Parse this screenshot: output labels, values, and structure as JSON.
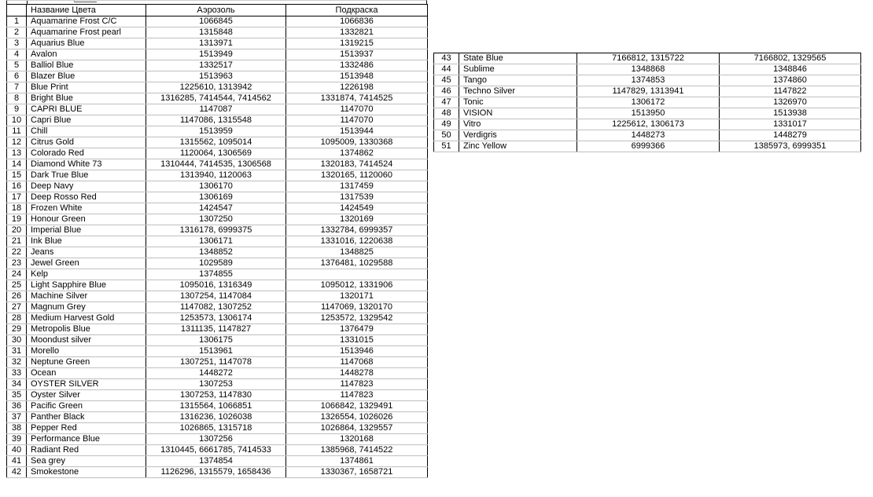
{
  "table": {
    "headers": {
      "row_number": "",
      "name": "Название Цвета",
      "aerosol": "Аэрозоль",
      "tint": "Подкраска"
    }
  },
  "left_table": {
    "rows": [
      {
        "n": "1",
        "name": "Aquamarine Frost C/C",
        "aerosol": "1066845",
        "tint": "1066836"
      },
      {
        "n": "2",
        "name": "Aquamarine Frost pearl",
        "aerosol": "1315848",
        "tint": "1332821"
      },
      {
        "n": "3",
        "name": "Aquarius Blue",
        "aerosol": "1313971",
        "tint": "1319215"
      },
      {
        "n": "4",
        "name": "Avalon",
        "aerosol": "1513949",
        "tint": "1513937"
      },
      {
        "n": "5",
        "name": "Balliol  Blue",
        "aerosol": "1332517",
        "tint": "1332486"
      },
      {
        "n": "6",
        "name": "Blazer Blue",
        "aerosol": "1513963",
        "tint": "1513948"
      },
      {
        "n": "7",
        "name": "Blue Print",
        "aerosol": "1225610, 1313942",
        "tint": "1226198"
      },
      {
        "n": "8",
        "name": "Bright Blue",
        "aerosol": "1316285, 7414544, 7414562",
        "tint": "1331874, 7414525"
      },
      {
        "n": "9",
        "name": "CAPRI BLUE",
        "aerosol": "1147087",
        "tint": "1147070"
      },
      {
        "n": "10",
        "name": "Capri Blue",
        "aerosol": "1147086, 1315548",
        "tint": "1147070"
      },
      {
        "n": "11",
        "name": "Chill",
        "aerosol": "1513959",
        "tint": "1513944"
      },
      {
        "n": "12",
        "name": "Citrus Gold",
        "aerosol": "1315562, 1095014",
        "tint": "1095009, 1330368"
      },
      {
        "n": "13",
        "name": "Colorado Red",
        "aerosol": "1120064, 1306569",
        "tint": "1374862"
      },
      {
        "n": "14",
        "name": "Diamond White 73",
        "aerosol": "1310444, 7414535, 1306568",
        "tint": "1320183, 7414524"
      },
      {
        "n": "15",
        "name": "Dark True Blue",
        "aerosol": "1313940, 1120063",
        "tint": "1320165, 1120060"
      },
      {
        "n": "16",
        "name": "Deep Navy",
        "aerosol": "1306170",
        "tint": "1317459"
      },
      {
        "n": "17",
        "name": "Deep Rosso Red",
        "aerosol": "1306169",
        "tint": "1317539"
      },
      {
        "n": "18",
        "name": "Frozen White",
        "aerosol": "1424547",
        "tint": "1424549"
      },
      {
        "n": "19",
        "name": "Honour  Green",
        "aerosol": "1307250",
        "tint": "1320169"
      },
      {
        "n": "20",
        "name": "Imperial Blue",
        "aerosol": "1316178, 6999375",
        "tint": "1332784, 6999357"
      },
      {
        "n": "21",
        "name": "Ink Blue",
        "aerosol": "1306171",
        "tint": "1331016, 1220638"
      },
      {
        "n": "22",
        "name": "Jeans",
        "aerosol": "1348852",
        "tint": "1348825"
      },
      {
        "n": "23",
        "name": "Jewel Green",
        "aerosol": "1029589",
        "tint": "1376481, 1029588"
      },
      {
        "n": "24",
        "name": "Kelp",
        "aerosol": "1374855",
        "tint": ""
      },
      {
        "n": "25",
        "name": "Light Sapphire Blue",
        "aerosol": "1095016, 1316349",
        "tint": "1095012, 1331906"
      },
      {
        "n": "26",
        "name": "Machine Silver",
        "aerosol": "1307254, 1147084",
        "tint": "1320171"
      },
      {
        "n": "27",
        "name": "Magnum Grey",
        "aerosol": "1147082, 1307252",
        "tint": "1147069, 1320170"
      },
      {
        "n": "28",
        "name": "Medium Harvest Gold",
        "aerosol": "1253573, 1306174",
        "tint": "1253572, 1329542"
      },
      {
        "n": "29",
        "name": "Metropolis Blue",
        "aerosol": "1311135, 1147827",
        "tint": "1376479"
      },
      {
        "n": "30",
        "name": "Moondust silver",
        "aerosol": "1306175",
        "tint": "1331015"
      },
      {
        "n": "31",
        "name": "Morello",
        "aerosol": "1513961",
        "tint": "1513946"
      },
      {
        "n": "32",
        "name": "Neptune Green",
        "aerosol": "1307251, 1147078",
        "tint": "1147068"
      },
      {
        "n": "33",
        "name": "Ocean",
        "aerosol": "1448272",
        "tint": "1448278"
      },
      {
        "n": "34",
        "name": "OYSTER SILVER",
        "aerosol": "1307253",
        "tint": "1147823"
      },
      {
        "n": "35",
        "name": "Oyster Silver",
        "aerosol": "1307253, 1147830",
        "tint": "1147823"
      },
      {
        "n": "36",
        "name": "Pacific Green",
        "aerosol": "1315564, 1066851",
        "tint": "1066842, 1329491"
      },
      {
        "n": "37",
        "name": "Panther Black",
        "aerosol": "1316236, 1026038",
        "tint": "1326554, 1026026"
      },
      {
        "n": "38",
        "name": "Pepper Red",
        "aerosol": "1026865, 1315718",
        "tint": "1026864, 1329557"
      },
      {
        "n": "39",
        "name": "Performance Blue",
        "aerosol": "1307256",
        "tint": "1320168"
      },
      {
        "n": "40",
        "name": "Radiant Red",
        "aerosol": "1310445, 6661785, 7414533",
        "tint": "1385968, 7414522"
      },
      {
        "n": "41",
        "name": "Sea grey",
        "aerosol": "1374854",
        "tint": "1374861"
      },
      {
        "n": "42",
        "name": "Smokestone",
        "aerosol": "1126296, 1315579, 1658436",
        "tint": "1330367, 1658721"
      }
    ]
  },
  "right_table": {
    "rows": [
      {
        "n": "43",
        "name": "State Blue",
        "aerosol": "7166812, 1315722",
        "tint": "7166802, 1329565"
      },
      {
        "n": "44",
        "name": "Sublime",
        "aerosol": "1348868",
        "tint": "1348846"
      },
      {
        "n": "45",
        "name": "Tango",
        "aerosol": "1374853",
        "tint": "1374860"
      },
      {
        "n": "46",
        "name": "Techno Silver",
        "aerosol": "1147829, 1313941",
        "tint": "1147822"
      },
      {
        "n": "47",
        "name": "Tonic",
        "aerosol": "1306172",
        "tint": "1326970"
      },
      {
        "n": "48",
        "name": "VISION",
        "aerosol": "1513950",
        "tint": "1513938"
      },
      {
        "n": "49",
        "name": "Vitro",
        "aerosol": "1225612, 1306173",
        "tint": "1331017"
      },
      {
        "n": "50",
        "name": "Verdigris",
        "aerosol": "1448273",
        "tint": "1448279"
      },
      {
        "n": "51",
        "name": "Zinc Yellow",
        "aerosol": "6999366",
        "tint": "1385973, 6999351"
      }
    ]
  },
  "colors": {
    "grid_outer": "#000000",
    "grid_inner": "#bfbfbf",
    "text": "#000000",
    "background": "#ffffff"
  }
}
